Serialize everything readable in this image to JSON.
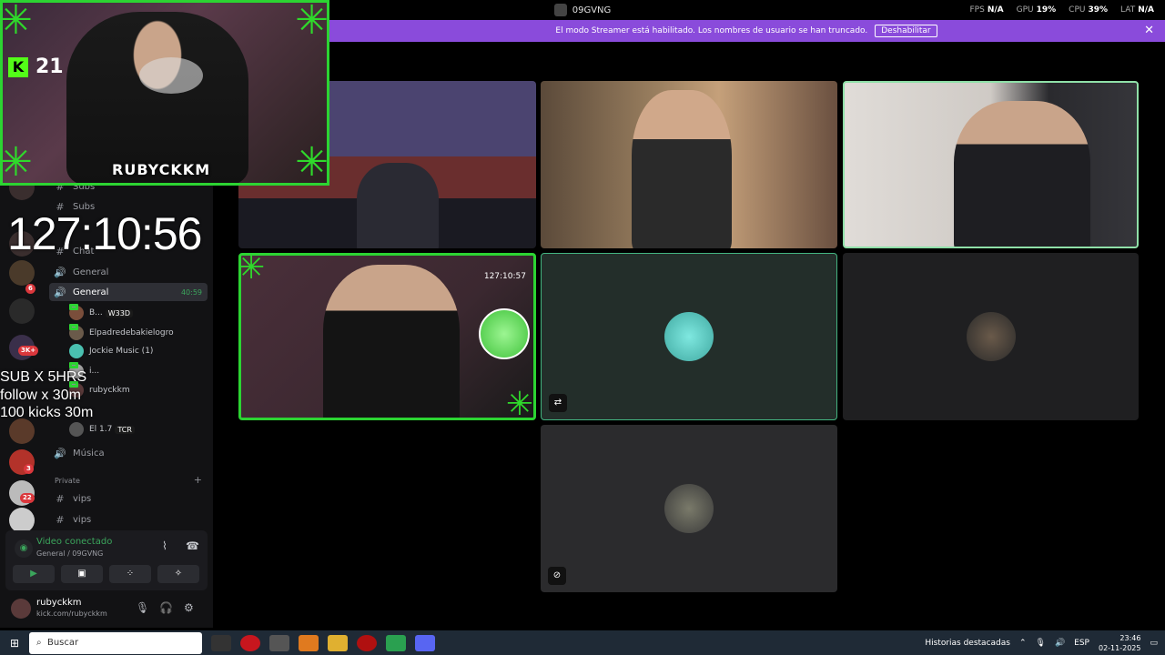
{
  "titlebar": {
    "server_name": "09GVNG",
    "fps_label": "FPS",
    "fps": "N/A",
    "gpu_label": "GPU",
    "gpu": "19%",
    "cpu_label": "CPU",
    "cpu": "39%",
    "lat_label": "LAT",
    "lat": "N/A"
  },
  "banner": {
    "message": "El modo Streamer está habilitado. Los nombres de usuario se han truncado.",
    "disable_button": "Deshabilitar",
    "close": "✕"
  },
  "overlay": {
    "kick_viewers": "21",
    "streamer_name": "RUBYCKKM",
    "timer": "127:10:56",
    "promo_lines": [
      "SUB X 5HRS",
      "follow x 30m",
      "100 kicks 30m"
    ]
  },
  "rail": {
    "badges": [
      "6",
      "3K+",
      "3",
      "22"
    ]
  },
  "channels": {
    "items": [
      {
        "label": "Subs",
        "icon": "#"
      },
      {
        "label": "Subs",
        "icon": "#"
      },
      {
        "label": "Chat",
        "icon": "#"
      },
      {
        "label": "General",
        "icon": "🔊"
      },
      {
        "label": "General",
        "icon": "🔊",
        "duration": "40:59"
      },
      {
        "label": "Música",
        "icon": "🔊"
      }
    ],
    "voice_users": [
      {
        "name": "B...",
        "tag": "W33D"
      },
      {
        "name": "Elpadredebakielogro",
        "tag": ""
      },
      {
        "name": "Jockie Music (1)",
        "tag": ""
      },
      {
        "name": "i...",
        "tag": ""
      },
      {
        "name": "rubyckkm",
        "tag": ""
      },
      {
        "name": "El 1.7",
        "tag": "TCR"
      }
    ],
    "category": "Private",
    "vips": [
      "vips",
      "vips"
    ]
  },
  "voice_panel": {
    "status": "Video conectado",
    "location": "General / 09GVNG"
  },
  "user_panel": {
    "username": "rubyckkm",
    "status": "kick.com/rubyckkm"
  },
  "tiles": {
    "stream_timer": "127:10:57",
    "stream_viewers": "21"
  },
  "taskbar": {
    "search": "Buscar",
    "widget": "Historias destacadas",
    "lang": "ESP",
    "time": "23:46",
    "date": "02-11-2025"
  },
  "colors": {
    "accent_green": "#2cd432",
    "streamer_purple": "#8a4bdb",
    "voice_green": "#3ba55c"
  }
}
